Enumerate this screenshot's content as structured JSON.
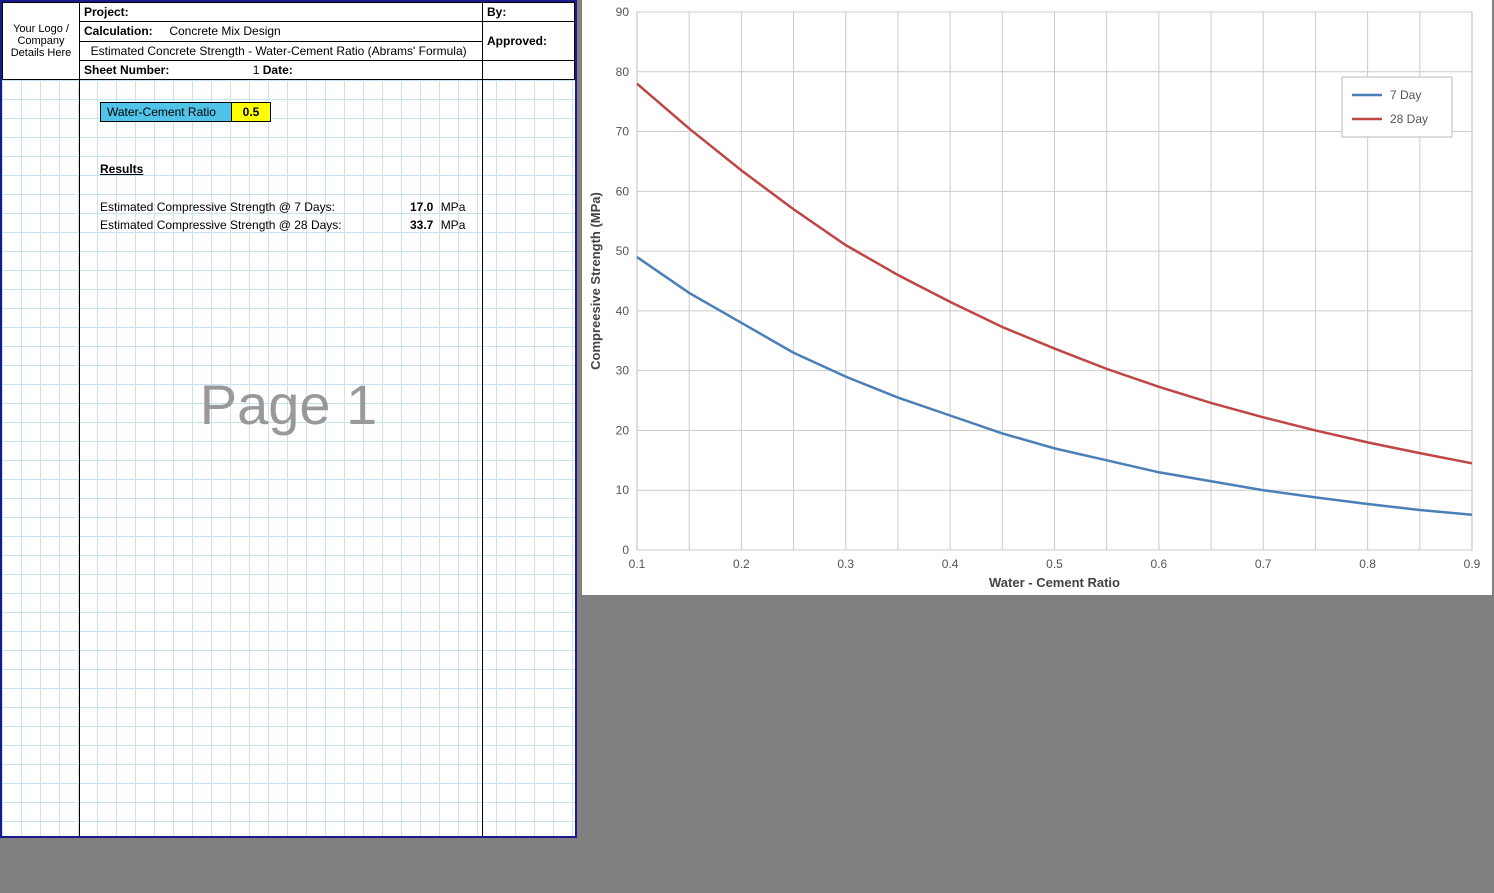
{
  "header": {
    "logo_placeholder": "Your Logo / Company Details Here",
    "project_label": "Project:",
    "project_value": "",
    "calculation_label": "Calculation:",
    "calculation_value": "Concrete Mix Design",
    "subtitle": "Estimated Concrete Strength - Water-Cement Ratio (Abrams' Formula)",
    "sheet_number_label": "Sheet Number:",
    "sheet_number_value": "1",
    "date_label": "Date:",
    "date_value": "",
    "by_label": "By:",
    "by_value": "",
    "approved_label": "Approved:",
    "approved_value": ""
  },
  "input": {
    "wc_label": "Water-Cement Ratio",
    "wc_value": "0.5"
  },
  "results": {
    "heading": "Results",
    "row1_label": "Estimated Compressive Strength @ 7 Days:",
    "row1_value": "17.0",
    "row1_unit": "MPa",
    "row2_label": "Estimated Compressive Strength @ 28 Days:",
    "row2_value": "33.7",
    "row2_unit": "MPa"
  },
  "watermark": "Page 1",
  "chart_data": {
    "type": "line",
    "xlabel": "Water  -  Cement Ratio",
    "ylabel": "Compreesive Strength (MPa)",
    "xlim": [
      0.1,
      0.9
    ],
    "ylim": [
      0,
      90
    ],
    "x_ticks": [
      0.1,
      0.2,
      0.3,
      0.4,
      0.5,
      0.6,
      0.7,
      0.8,
      0.9
    ],
    "y_ticks": [
      0,
      10,
      20,
      30,
      40,
      50,
      60,
      70,
      80,
      90
    ],
    "x_gridlines": [
      0.15,
      0.2,
      0.25,
      0.3,
      0.35,
      0.4,
      0.45,
      0.5,
      0.55,
      0.6,
      0.65,
      0.7,
      0.75,
      0.8,
      0.85
    ],
    "legend": {
      "items": [
        "7 Day",
        "28 Day"
      ]
    },
    "series": [
      {
        "name": "7 Day",
        "x": [
          0.1,
          0.15,
          0.2,
          0.25,
          0.3,
          0.35,
          0.4,
          0.45,
          0.5,
          0.55,
          0.6,
          0.65,
          0.7,
          0.75,
          0.8,
          0.85,
          0.9
        ],
        "y": [
          49,
          43,
          38,
          33,
          29,
          25.5,
          22.5,
          19.5,
          17,
          15,
          13,
          11.5,
          10,
          8.8,
          7.7,
          6.7,
          5.9
        ]
      },
      {
        "name": "28 Day",
        "x": [
          0.1,
          0.15,
          0.2,
          0.25,
          0.3,
          0.35,
          0.4,
          0.45,
          0.5,
          0.55,
          0.6,
          0.65,
          0.7,
          0.75,
          0.8,
          0.85,
          0.9
        ],
        "y": [
          78,
          70.5,
          63.5,
          57,
          51,
          46,
          41.5,
          37.3,
          33.7,
          30.3,
          27.3,
          24.6,
          22.2,
          20,
          18,
          16.2,
          14.5
        ]
      }
    ]
  }
}
